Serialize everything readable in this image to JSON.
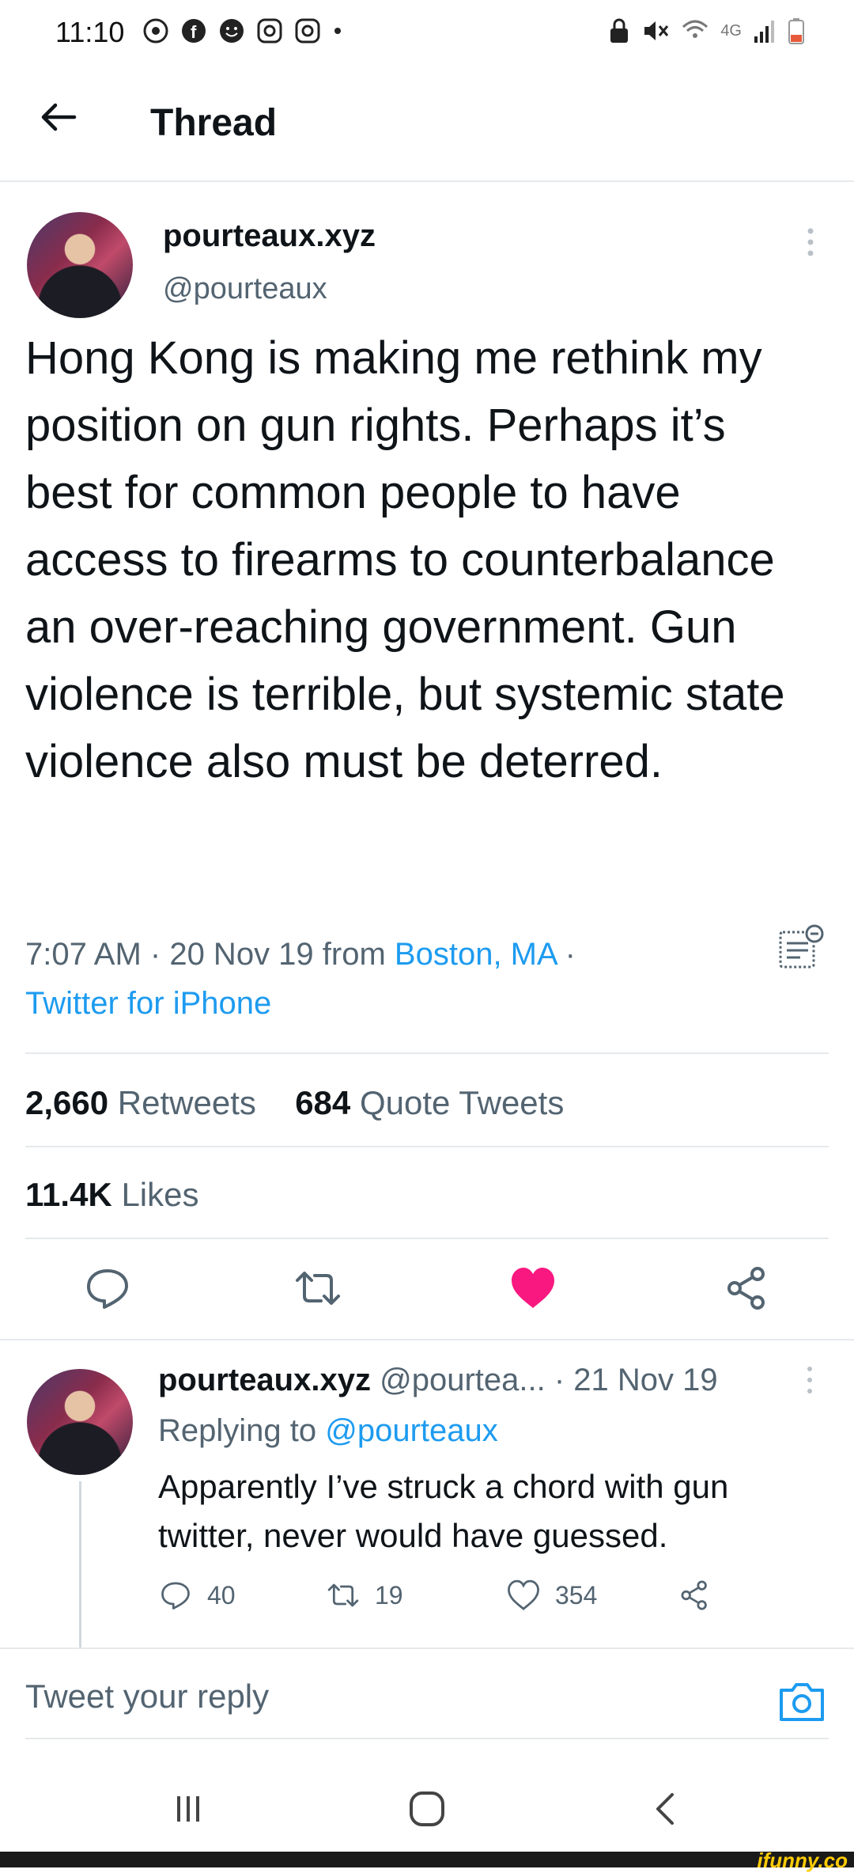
{
  "status_bar": {
    "time": "11:10",
    "network": "4G"
  },
  "header": {
    "title": "Thread"
  },
  "main_tweet": {
    "display_name": "pourteaux.xyz",
    "handle": "@pourteaux",
    "text": "Hong Kong is making me rethink my position on gun rights. Perhaps it’s best for common people to have access to firearms to counterbalance an over-reaching government. Gun violence is terrible, but systemic state violence also must be deterred.",
    "time": "7:07 AM",
    "date": "20 Nov 19",
    "from_label": "from",
    "location": "Boston, MA",
    "client": "Twitter for iPhone",
    "retweets_count": "2,660",
    "retweets_label": "Retweets",
    "quote_count": "684",
    "quote_label": "Quote Tweets",
    "likes_count": "11.4K",
    "likes_label": "Likes",
    "liked": true,
    "like_color": "#f91880"
  },
  "reply_tweet": {
    "display_name": "pourteaux.xyz",
    "handle": "@pourtea...",
    "date": "21 Nov 19",
    "replying_label": "Replying to",
    "replying_handle": "@pourteaux",
    "text": "Apparently I’ve struck a chord with gun twitter, never would have guessed.",
    "reply_count": "40",
    "retweet_count": "19",
    "like_count": "354"
  },
  "compose": {
    "placeholder": "Tweet your reply"
  },
  "watermark": {
    "text": "ifunny.co"
  },
  "colors": {
    "accent": "#1d9bf0",
    "secondary_text": "#536471"
  }
}
